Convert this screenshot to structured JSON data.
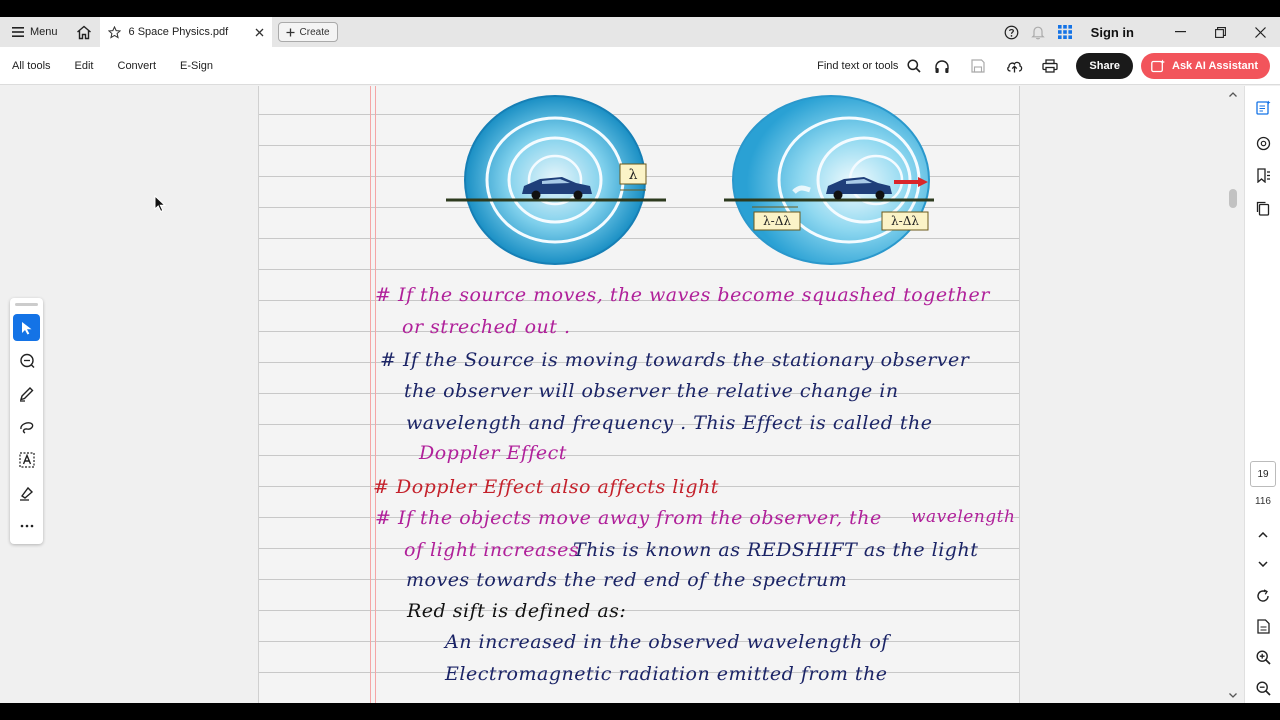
{
  "tabbar": {
    "menu_label": "Menu",
    "tab_title": "6 Space Physics.pdf",
    "create_label": "Create",
    "signin_label": "Sign in"
  },
  "toolbar": {
    "items": [
      "All tools",
      "Edit",
      "Convert",
      "E-Sign"
    ],
    "find_label": "Find text or tools",
    "share_label": "Share",
    "ai_label": "Ask AI Assistant"
  },
  "figure": {
    "label_lambda": "λ",
    "label_shorter": "λ-Δλ",
    "label_right": "λ-Δλ"
  },
  "notes": {
    "line1": "# If the source moves, the waves become squashed together",
    "line2": "or streched out .",
    "line3": "# If the Source is moving towards the stationary observer",
    "line4": "the observer will observer the relative change in",
    "line5": "wavelength and frequency . This Effect is called the",
    "line6": "Doppler Effect",
    "line7": "# Doppler Effect also affects light",
    "line8a": "# If the objects move away from the observer, the",
    "line8b": "wavelength",
    "line9a": "of light increases .",
    "line9b": "This is known as REDSHIFT as the light",
    "line10": "moves towards the red end of the spectrum",
    "line11": "Red sift is defined as:",
    "line12": "An increased in the observed wavelength of",
    "line13": "Electromagnetic radiation emitted from the"
  },
  "navigation": {
    "current_page": "19",
    "total_pages": "116"
  },
  "colors": {
    "accent": "#1473e6",
    "ai_button": "#f2545b",
    "ink_magenta": "#b0209a",
    "ink_navy": "#1b2466",
    "ink_red": "#c4212b"
  }
}
